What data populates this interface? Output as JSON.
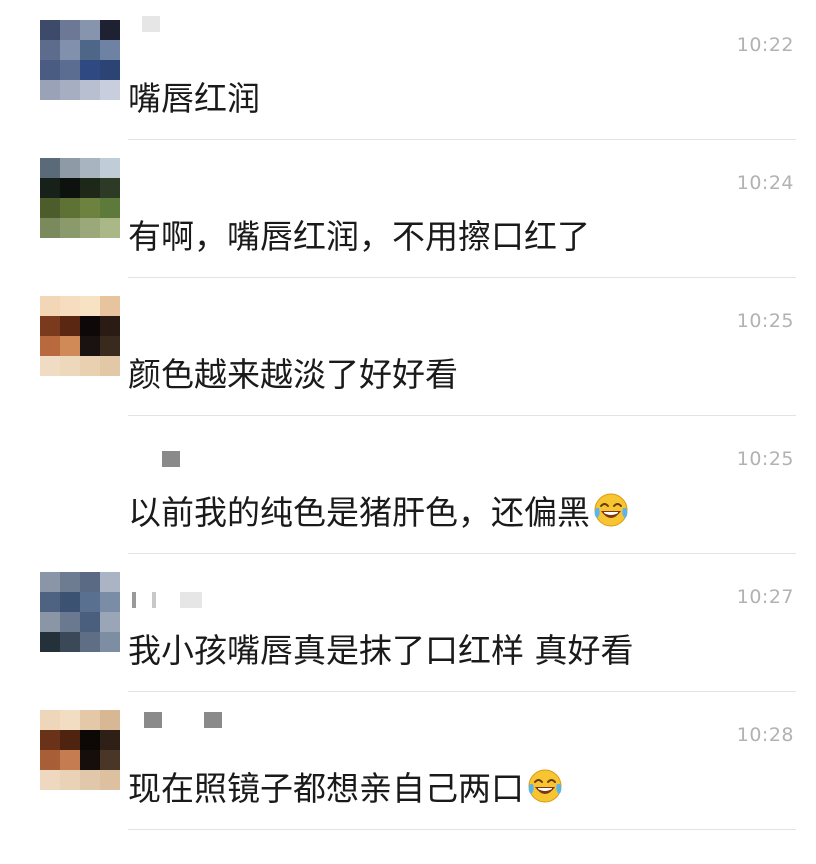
{
  "comments": [
    {
      "time": "10:22",
      "text": "嘴唇红润",
      "emoji": "",
      "avatar_colors": [
        "#3d4a6a",
        "#6c7896",
        "#8794ae",
        "#1d2132",
        "#5d6b8c",
        "#8190ad",
        "#4e6688",
        "#6e82a4",
        "#4a5c82",
        "#5b6d91",
        "#2f4a82",
        "#2b4474",
        "#9aa2b8",
        "#a6aec2",
        "#b7bfd0",
        "#c8cede"
      ]
    },
    {
      "time": "10:24",
      "text": "有啊，嘴唇红润，不用擦口红了",
      "emoji": "",
      "avatar_colors": [
        "#5a6a78",
        "#8e9aa6",
        "#a8b4c0",
        "#c0ccd6",
        "#18201a",
        "#0e120e",
        "#1e2818",
        "#2c3a26",
        "#4c5c2a",
        "#5e7236",
        "#6e8240",
        "#5e7a3a",
        "#7a8a5c",
        "#8a9a6a",
        "#9aa87a",
        "#aab888"
      ]
    },
    {
      "time": "10:25",
      "text": "颜色越来越淡了好好看",
      "emoji": "",
      "avatar_colors": [
        "#f2d6b6",
        "#f6ddbf",
        "#f8e2c4",
        "#e8c49e",
        "#7a3a1e",
        "#5a2812",
        "#0e0808",
        "#2a1c14",
        "#b86a3e",
        "#d08a58",
        "#1a1210",
        "#3a2a1e",
        "#f0dcc4",
        "#eed8bc",
        "#e8d0b0",
        "#e2c8a6"
      ]
    },
    {
      "time": "10:25",
      "text": "以前我的纯色是猪肝色，还偏黑",
      "emoji": "laughing-tears",
      "avatar_colors": []
    },
    {
      "time": "10:27",
      "text": "我小孩嘴唇真是抹了口红样 真好看",
      "emoji": "",
      "avatar_colors": [
        "#8a96a8",
        "#6e7c92",
        "#5a6a84",
        "#aab4c4",
        "#4e6282",
        "#3c5272",
        "#5a7090",
        "#7a8ca6",
        "#8a96a6",
        "#6a7890",
        "#4a5e7e",
        "#9aa6b8",
        "#24303a",
        "#3a4858",
        "#5e6e84",
        "#7e8ea2"
      ]
    },
    {
      "time": "10:28",
      "text": "现在照镜子都想亲自己两口",
      "emoji": "laughing-tears",
      "avatar_colors": [
        "#eed6ba",
        "#f2dcc2",
        "#e4c8a8",
        "#d8b894",
        "#6a3218",
        "#4e2410",
        "#0c0806",
        "#2e2016",
        "#a85e36",
        "#c47c50",
        "#160e0a",
        "#4a3626",
        "#eed8c0",
        "#ead2b6",
        "#e2c8aa",
        "#dcc0a0"
      ]
    }
  ]
}
